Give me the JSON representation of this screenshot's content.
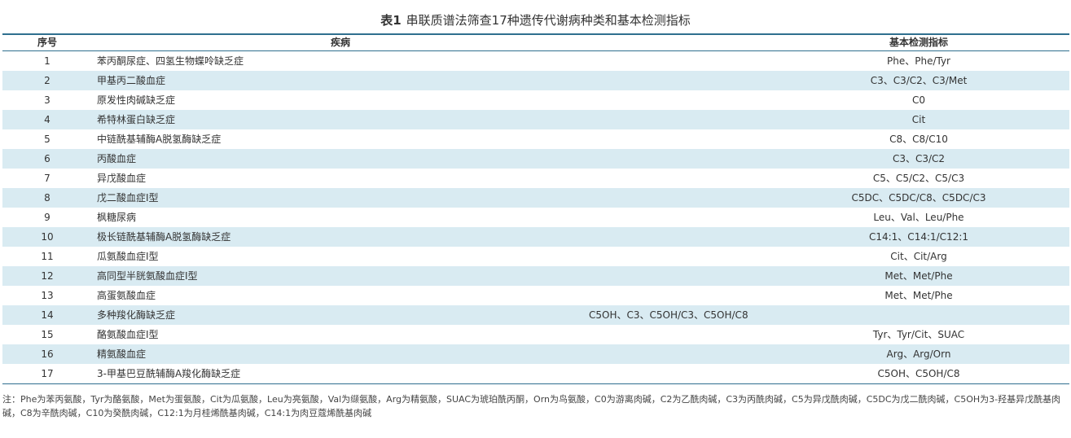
{
  "caption": {
    "label": "表1",
    "title": "串联质谱法筛查17种遗传代谢病种类和基本检测指标"
  },
  "table": {
    "headers": {
      "no": "序号",
      "disease": "疾病",
      "indicator": "基本检测指标"
    },
    "rows": [
      {
        "no": "1",
        "disease": "苯丙酮尿症、四氢生物蝶呤缺乏症",
        "indicator": "Phe、Phe/Tyr"
      },
      {
        "no": "2",
        "disease": "甲基丙二酸血症",
        "indicator": "C3、C3/C2、C3/Met"
      },
      {
        "no": "3",
        "disease": "原发性肉碱缺乏症",
        "indicator": "C0"
      },
      {
        "no": "4",
        "disease": "希特林蛋白缺乏症",
        "indicator": "Cit"
      },
      {
        "no": "5",
        "disease": "中链酰基辅酶A脱氢酶缺乏症",
        "indicator": "C8、C8/C10"
      },
      {
        "no": "6",
        "disease": "丙酸血症",
        "indicator": "C3、C3/C2"
      },
      {
        "no": "7",
        "disease": "异戊酸血症",
        "indicator": "C5、C5/C2、C5/C3"
      },
      {
        "no": "8",
        "disease": "戊二酸血症Ⅰ型",
        "indicator": "C5DC、C5DC/C8、C5DC/C3"
      },
      {
        "no": "9",
        "disease": "枫糖尿病",
        "indicator": "Leu、Val、Leu/Phe"
      },
      {
        "no": "10",
        "disease": "极长链酰基辅酶A脱氢酶缺乏症",
        "indicator": "C14:1、C14:1/C12:1"
      },
      {
        "no": "11",
        "disease": "瓜氨酸血症Ⅰ型",
        "indicator": "Cit、Cit/Arg"
      },
      {
        "no": "12",
        "disease": "高同型半胱氨酸血症Ⅰ型",
        "indicator": "Met、Met/Phe"
      },
      {
        "no": "13",
        "disease": "高蛋氨酸血症",
        "indicator": "Met、Met/Phe"
      },
      {
        "no": "14",
        "disease": "多种羧化酶缺乏症",
        "indicator": "C5OH、C3、C5OH/C3、C5OH/C8"
      },
      {
        "no": "15",
        "disease": "酪氨酸血症Ⅰ型",
        "indicator": "Tyr、Tyr/Cit、SUAC"
      },
      {
        "no": "16",
        "disease": "精氨酸血症",
        "indicator": "Arg、Arg/Orn"
      },
      {
        "no": "17",
        "disease": "3-甲基巴豆酰辅酶A羧化酶缺乏症",
        "indicator": "C5OH、C5OH/C8"
      }
    ]
  },
  "note": "注：Phe为苯丙氨酸，Tyr为酪氨酸，Met为蛋氨酸，Cit为瓜氨酸，Leu为亮氨酸，Val为缬氨酸，Arg为精氨酸，SUAC为琥珀酰丙酮，Orn为鸟氨酸，C0为游离肉碱，C2为乙酰肉碱，C3为丙酰肉碱，C5为异戊酰肉碱，C5DC为戊二酰肉碱，C5OH为3-羟基异戊酰基肉碱，C8为辛酰肉碱，C10为癸酰肉碱，C12:1为月桂烯酰基肉碱，C14:1为肉豆蔻烯酰基肉碱"
}
